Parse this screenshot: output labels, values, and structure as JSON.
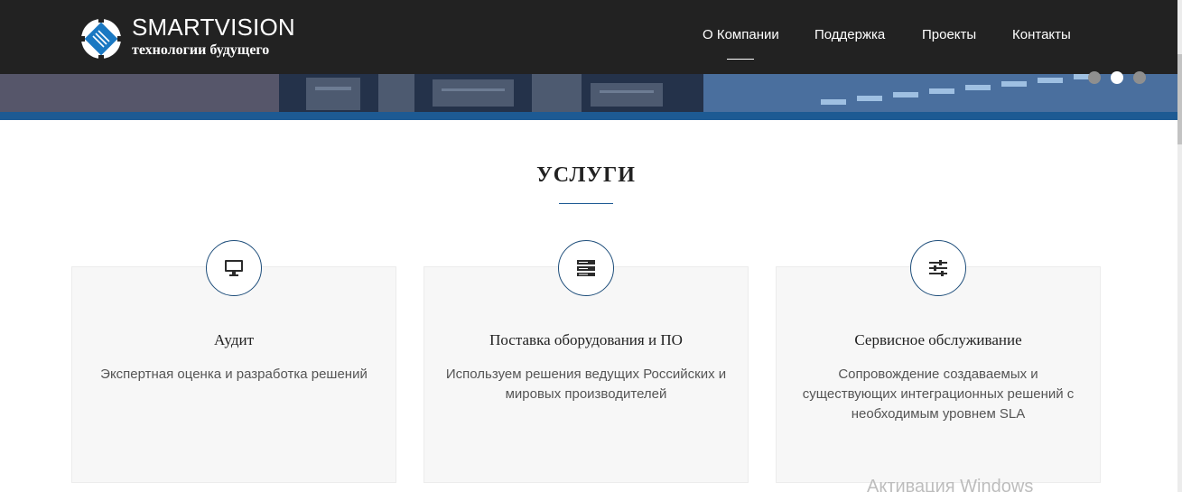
{
  "header": {
    "brand_name": "SMARTVISION",
    "brand_tagline": "технологии будущего",
    "nav": [
      {
        "label": "О Компании",
        "active": true
      },
      {
        "label": "Поддержка",
        "active": false
      },
      {
        "label": "Проекты",
        "active": false
      },
      {
        "label": "Контакты",
        "active": false
      }
    ]
  },
  "slider": {
    "dots": 3,
    "active_index": 1
  },
  "services": {
    "title": "УСЛУГИ",
    "cards": [
      {
        "icon": "monitor-icon",
        "title": "Аудит",
        "text": "Экспертная оценка и разработка решений"
      },
      {
        "icon": "server-icon",
        "title": "Поставка оборудования и ПО",
        "text": "Используем решения ведущих Российских и мировых производителей"
      },
      {
        "icon": "sliders-icon",
        "title": "Сервисное обслуживание",
        "text": "Сопровождение создаваемых и существующих интеграционных решений с необходимым уровнем SLA"
      }
    ]
  },
  "watermark": "Активация Windows",
  "colors": {
    "header_bg": "#222222",
    "accent": "#1d5a93",
    "card_bg": "#f7f7f7"
  }
}
